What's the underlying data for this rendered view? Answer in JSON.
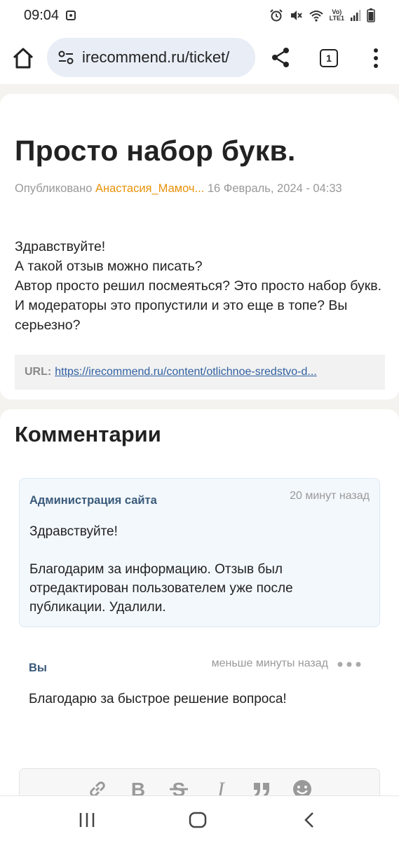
{
  "status_bar": {
    "time": "09:04",
    "network_label_top": "Vo)",
    "network_label_bottom": "LTE1"
  },
  "browser": {
    "url": "irecommend.ru/ticket/",
    "tab_count": "1"
  },
  "ticket": {
    "title": "Просто набор букв.",
    "published_label": "Опубликовано",
    "author": "Анастасия_Мамоч...",
    "date": "16 Февраль, 2024 - 04:33",
    "body": [
      "Здравствуйте!",
      "А такой отзыв можно писать?",
      "Автор просто решил посмеяться? Это просто набор букв. И модераторы это пропустили и это еще в топе? Вы серьезно?"
    ],
    "url_label": "URL:",
    "url_link": "https://irecommend.ru/content/otlichnoe-sredstvo-d..."
  },
  "comments": {
    "title": "Комментарии",
    "items": [
      {
        "author": "Администрация сайта",
        "time": "20 минут назад",
        "greeting": "Здравствуйте!",
        "text": "Благодарим за информацию. Отзыв был отредактирован пользователем уже после публикации. Удалили."
      },
      {
        "author": "Вы",
        "time": "меньше минуты назад",
        "text": "Благодарю за быстрое решение вопроса!"
      }
    ]
  },
  "editor": {
    "buttons": [
      "link-icon",
      "bold-icon",
      "strikethrough-icon",
      "italic-icon",
      "quote-icon",
      "emoji-icon"
    ]
  },
  "colors": {
    "author_accent": "#e8920a",
    "link": "#2f5fa0",
    "comment_author": "#3a5a7a",
    "admin_comment_bg": "#f3f8fd"
  }
}
